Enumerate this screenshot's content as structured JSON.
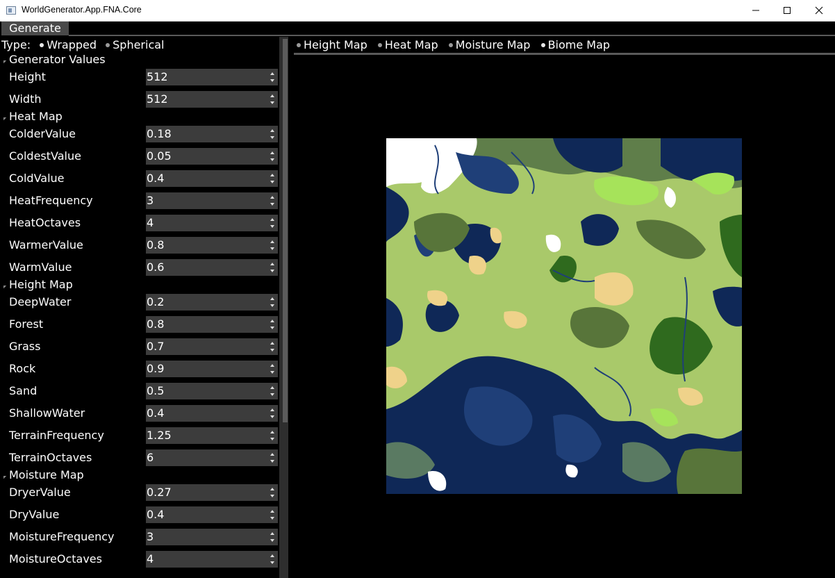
{
  "window": {
    "title": "WorldGenerator.App.FNA.Core",
    "controls": [
      "minimize-icon",
      "maximize-icon",
      "close-icon"
    ]
  },
  "menu": {
    "generate_label": "Generate"
  },
  "type_selector": {
    "label": "Type:",
    "options": [
      "Wrapped",
      "Spherical"
    ],
    "selected": "Wrapped"
  },
  "sections": {
    "generator": {
      "title": "Generator Values",
      "properties": [
        {
          "label": "Height",
          "value": "512"
        },
        {
          "label": "Width",
          "value": "512"
        }
      ]
    },
    "heat": {
      "title": "Heat Map",
      "properties": [
        {
          "label": "ColderValue",
          "value": "0.18"
        },
        {
          "label": "ColdestValue",
          "value": "0.05"
        },
        {
          "label": "ColdValue",
          "value": "0.4"
        },
        {
          "label": "HeatFrequency",
          "value": "3"
        },
        {
          "label": "HeatOctaves",
          "value": "4"
        },
        {
          "label": "WarmerValue",
          "value": "0.8"
        },
        {
          "label": "WarmValue",
          "value": "0.6"
        }
      ]
    },
    "height": {
      "title": "Height Map",
      "properties": [
        {
          "label": "DeepWater",
          "value": "0.2"
        },
        {
          "label": "Forest",
          "value": "0.8"
        },
        {
          "label": "Grass",
          "value": "0.7"
        },
        {
          "label": "Rock",
          "value": "0.9"
        },
        {
          "label": "Sand",
          "value": "0.5"
        },
        {
          "label": "ShallowWater",
          "value": "0.4"
        },
        {
          "label": "TerrainFrequency",
          "value": "1.25"
        },
        {
          "label": "TerrainOctaves",
          "value": "6"
        }
      ]
    },
    "moisture": {
      "title": "Moisture Map",
      "properties": [
        {
          "label": "DryerValue",
          "value": "0.27"
        },
        {
          "label": "DryValue",
          "value": "0.4"
        },
        {
          "label": "MoistureFrequency",
          "value": "3"
        },
        {
          "label": "MoistureOctaves",
          "value": "4"
        }
      ]
    }
  },
  "map_tabs": {
    "options": [
      "Height Map",
      "Heat Map",
      "Moisture Map",
      "Biome Map"
    ],
    "selected": "Biome Map"
  },
  "colors": {
    "deep_water": "#0f2857",
    "shallow_water": "#1f3f78",
    "grassland": "#a9c96a",
    "light_grass": "#bcd47d",
    "forest": "#58753a",
    "dense_forest": "#2f6a1e",
    "desert": "#efd28a",
    "tundra": "#5a7a62",
    "snow": "#ffffff",
    "bright_grass": "#a6e35a"
  }
}
